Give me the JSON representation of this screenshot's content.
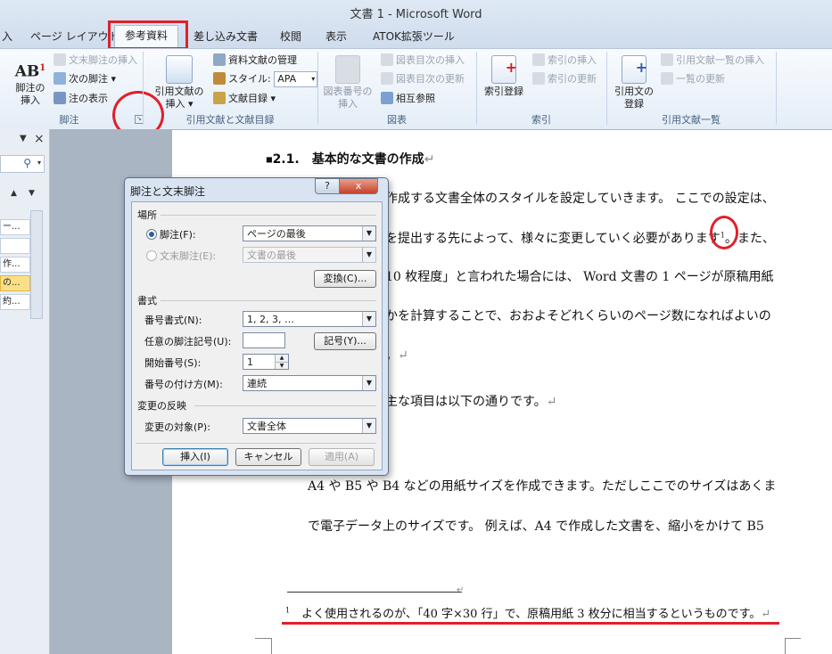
{
  "window": {
    "title": "文書 1  -  Microsoft Word"
  },
  "tabs": [
    {
      "label": "入"
    },
    {
      "label": "ページ レイアウト"
    },
    {
      "label": "参考資料"
    },
    {
      "label": "差し込み文書"
    },
    {
      "label": "校閲"
    },
    {
      "label": "表示"
    },
    {
      "label": "ATOK拡張ツール"
    }
  ],
  "ribbon": {
    "footnotes": {
      "group_label": "脚注",
      "insert_label_1": "脚注の",
      "insert_label_2": "挿入",
      "ab_glyph": "AB",
      "ab_sup": "1",
      "endnote": "文末脚注の挿入",
      "next": "次の脚注",
      "show": "注の表示"
    },
    "citations": {
      "group_label": "引用文献と文献目録",
      "insert_label_1": "引用文献の",
      "insert_label_2": "挿入",
      "manage": "資料文献の管理",
      "style_label": "スタイル:",
      "style_value": "APA",
      "bibliography": "文献目録"
    },
    "captions": {
      "group_label": "図表",
      "insert_label_1": "図表番号の",
      "insert_label_2": "挿入",
      "toc": "図表目次の挿入",
      "update": "図表目次の更新",
      "cross": "相互参照"
    },
    "index": {
      "group_label": "索引",
      "mark_label": "索引登録",
      "insert": "索引の挿入",
      "update": "索引の更新"
    },
    "authorities": {
      "group_label": "引用文献一覧",
      "mark_label_1": "引用文の",
      "mark_label_2": "登録",
      "insert": "引用文献一覧の挿入",
      "update": "一覧の更新"
    }
  },
  "nav": {
    "close": "×",
    "items": [
      "ー...",
      "",
      "作...",
      "の...",
      "約..."
    ]
  },
  "dialog": {
    "title": "脚注と文末脚注",
    "help": "?",
    "close": "x",
    "location_header": "場所",
    "footnote_label": "脚注(F):",
    "footnote_value": "ページの最後",
    "endnote_label": "文末脚注(E):",
    "endnote_value": "文書の最後",
    "convert_button": "変換(C)...",
    "format_header": "書式",
    "number_format_label": "番号書式(N):",
    "number_format_value": "1, 2, 3, …",
    "custom_mark_label": "任意の脚注記号(U):",
    "custom_mark_value": "",
    "symbol_button": "記号(Y)...",
    "start_label": "開始番号(S):",
    "start_value": "1",
    "numbering_label": "番号の付け方(M):",
    "numbering_value": "連続",
    "apply_header": "変更の反映",
    "apply_to_label": "変更の対象(P):",
    "apply_to_value": "文書全体",
    "insert_button": "挿入(I)",
    "cancel_button": "キャンセル",
    "apply_button": "適用(A)"
  },
  "document": {
    "heading_number": "2.1.",
    "heading_text": "基本的な文書の作成",
    "lines": [
      "作成する文書全体のスタイルを設定していきます。 ここでの設定は、",
      "を提出する先によって、様々に変更していく必要があります",
      "10 枚程度」と言われた場合には、 Word  文書の 1 ページが原稿用紙",
      "かを計算することで、おおよそどれくらいのページ数になればよいの",
      "。",
      "主な項目は以下の通りです。",
      "A4 や B5 や B4 などの用紙サイズを作成できます。ただしここでのサイズはあくま",
      "で電子データ上のサイズです。  例えば、A4  で作成した文書を、縮小をかけて  B5"
    ],
    "footnote_ref": "1",
    "line2_suffix": "。また、",
    "footnote_number": "1",
    "footnote_text": "よく使用されるのが、「40 字×30 行」で、原稿用紙 3 枚分に相当するというものです。"
  },
  "colors": {
    "highlight": "#e0202a",
    "ribbon_bg": "#e4edf7"
  }
}
